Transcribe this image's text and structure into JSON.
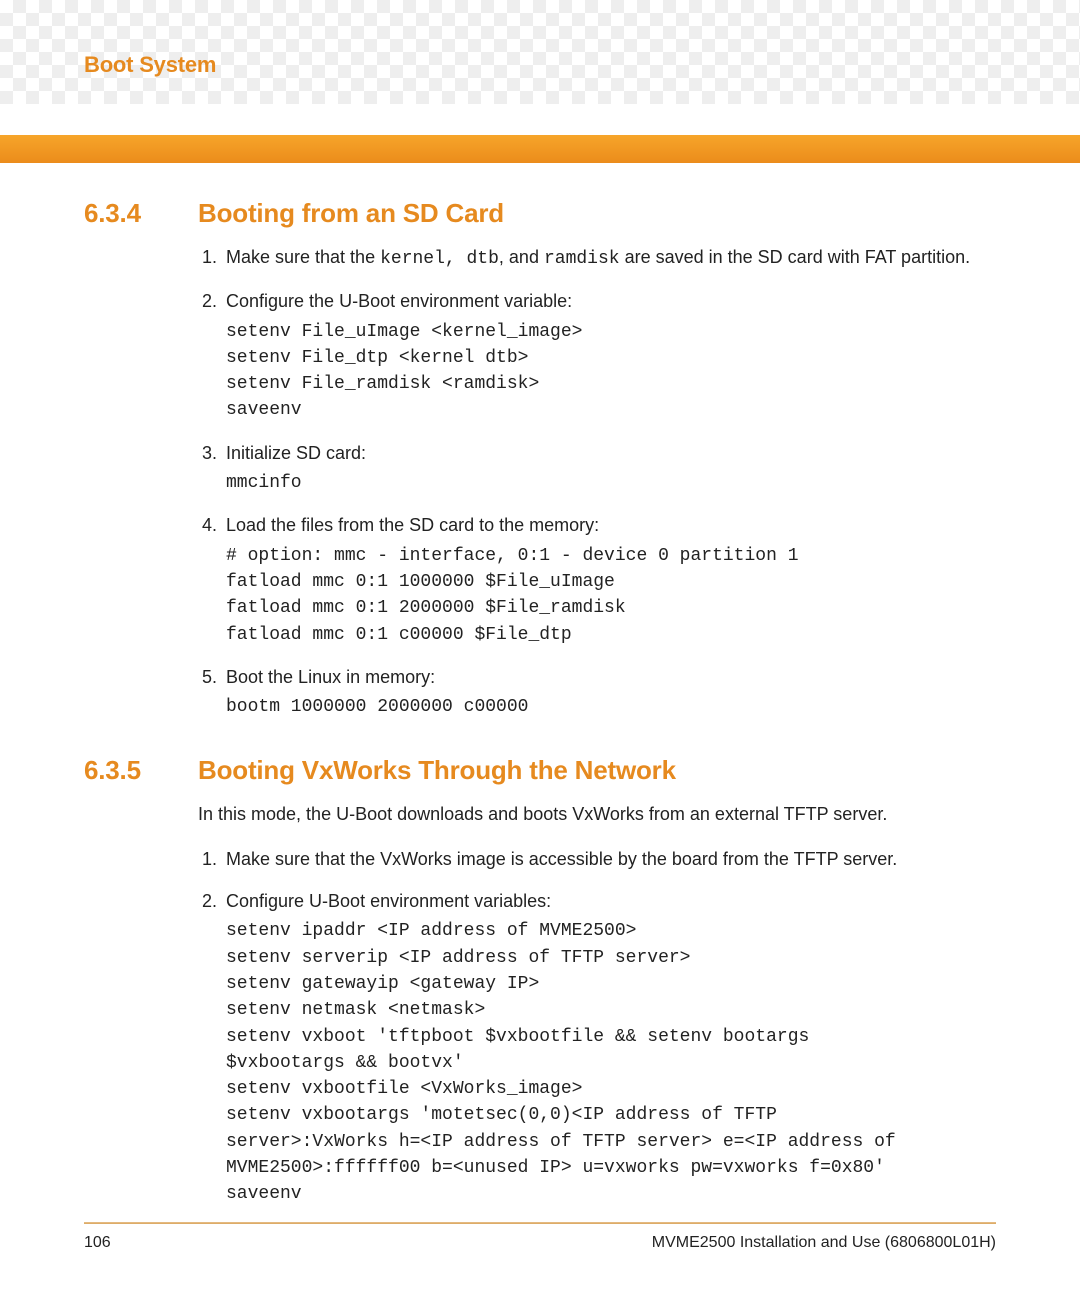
{
  "chapter": "Boot System",
  "sections": [
    {
      "num": "6.3.4",
      "title": "Booting from an SD Card",
      "intro": "",
      "items": [
        {
          "preText": "Make sure that the ",
          "mono1": "kernel, dtb",
          "midText": ", and ",
          "mono2": "ramdisk",
          "postText": " are saved in the SD card with FAT partition.",
          "code": ""
        },
        {
          "text": "Configure the U-Boot environment variable:",
          "code": "setenv File_uImage <kernel_image>\nsetenv File_dtp <kernel dtb>\nsetenv File_ramdisk <ramdisk>\nsaveenv"
        },
        {
          "text": "Initialize SD card:",
          "code": "mmcinfo"
        },
        {
          "text": "Load the files from the SD card to the memory:",
          "code": "# option: mmc - interface, 0:1 - device 0 partition 1\nfatload mmc 0:1 1000000 $File_uImage\nfatload mmc 0:1 2000000 $File_ramdisk\nfatload mmc 0:1 c00000 $File_dtp"
        },
        {
          "text": "Boot the Linux in memory:",
          "code": "bootm 1000000 2000000 c00000"
        }
      ]
    },
    {
      "num": "6.3.5",
      "title": "Booting VxWorks Through the Network",
      "intro": "In this mode, the U-Boot downloads and boots VxWorks from an external TFTP server.",
      "items": [
        {
          "text": "Make sure that the VxWorks image is accessible by the board from the TFTP server.",
          "code": ""
        },
        {
          "text": "Configure U-Boot environment variables:",
          "code": "setenv ipaddr <IP address of MVME2500>\nsetenv serverip <IP address of TFTP server>\nsetenv gatewayip <gateway IP>\nsetenv netmask <netmask>\nsetenv vxboot 'tftpboot $vxbootfile && setenv bootargs\n$vxbootargs && bootvx'\nsetenv vxbootfile <VxWorks_image>\nsetenv vxbootargs 'motetsec(0,0)<IP address of TFTP\nserver>:VxWorks h=<IP address of TFTP server> e=<IP address of\nMVME2500>:ffffff00 b=<unused IP> u=vxworks pw=vxworks f=0x80'\nsaveenv"
        }
      ]
    }
  ],
  "footer": {
    "page": "106",
    "docref": "MVME2500 Installation and Use (6806800L01H)"
  }
}
